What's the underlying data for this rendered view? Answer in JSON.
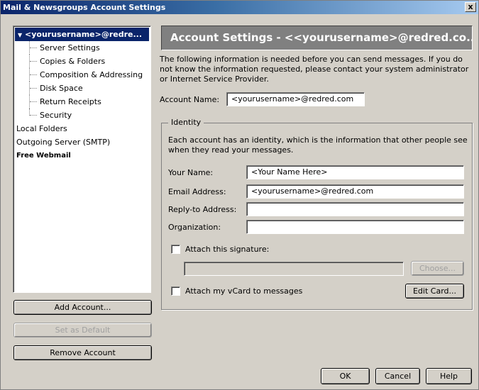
{
  "window": {
    "title": "Mail & Newsgroups Account Settings",
    "close_label": "x"
  },
  "tree": {
    "root": "<yourusername>@redre...",
    "root_icon": "chevron-down-icon",
    "children": [
      "Server Settings",
      "Copies & Folders",
      "Composition & Addressing",
      "Disk Space",
      "Return Receipts",
      "Security"
    ],
    "local_folders": "Local Folders",
    "outgoing_server": "Outgoing Server (SMTP)",
    "free_webmail": "Free Webmail"
  },
  "buttons": {
    "add_account": "Add Account...",
    "set_default": "Set as Default",
    "remove_account": "Remove Account",
    "choose": "Choose...",
    "edit_card": "Edit Card...",
    "ok": "OK",
    "cancel": "Cancel",
    "help": "Help"
  },
  "main": {
    "header": "Account Settings - <<yourusername>@redred.co...",
    "intro_text": "The following information is needed before you can send messages. If you do not know the information requested, please contact your system administrator or Internet Service Provider.",
    "account_name_label": "Account Name:",
    "account_name_value": "<yourusername>@redred.com"
  },
  "identity": {
    "legend": "Identity",
    "description": "Each account has an identity, which is the information that other people see when they read your messages.",
    "your_name_label": "Your Name:",
    "your_name_value": "<Your Name Here>",
    "email_label": "Email Address:",
    "email_value": "<yourusername>@redred.com",
    "reply_to_label": "Reply-to Address:",
    "reply_to_value": "",
    "organization_label": "Organization:",
    "organization_value": "",
    "attach_signature_label": "Attach this signature:",
    "attach_signature_checked": false,
    "signature_path": "",
    "attach_vcard_label": "Attach my vCard to messages",
    "attach_vcard_checked": false
  },
  "colors": {
    "titlebar_start": "#0a246a",
    "titlebar_end": "#a6caf0",
    "selection": "#0a246a",
    "panel_header": "#808080",
    "dialog_face": "#d4d0c8"
  }
}
